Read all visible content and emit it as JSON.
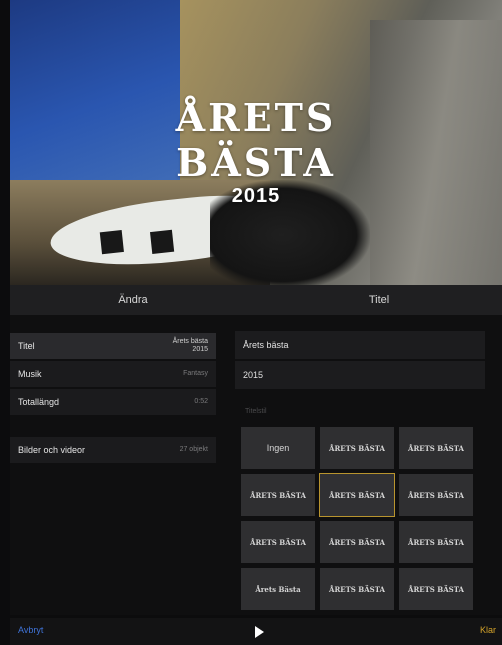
{
  "hero": {
    "line1": "ÅRETS",
    "line2": "BÄSTA",
    "year": "2015"
  },
  "tabs": {
    "left": "Ändra",
    "right": "Titel"
  },
  "settings": [
    {
      "label": "Titel",
      "value": "Årets bästa\n2015"
    },
    {
      "label": "Musik",
      "value": "Fantasy"
    },
    {
      "label": "Totallängd",
      "value": "0:52"
    }
  ],
  "media": {
    "label": "Bilder och videor",
    "value": "27 objekt"
  },
  "title_fields": {
    "line1": "Årets bästa",
    "line2": "2015"
  },
  "styles_label": "Titelstil",
  "styles": [
    "Ingen",
    "ÅRETS BÄSTA",
    "ÅRETS BÄSTA",
    "ÅRETS BÄSTA",
    "ÅRETS BÄSTA",
    "ÅRETS BÄSTA",
    "ÅRETS BÄSTA",
    "ÅRETS BÄSTA",
    "ÅRETS BÄSTA",
    "Årets Bästa",
    "ÅRETS BÄSTA",
    "ÅRETS BÄSTA"
  ],
  "bottom": {
    "left": "Avbryt",
    "right": "Klar"
  },
  "colors": {
    "accent_blue": "#3f73d8",
    "accent_gold": "#d4a32a"
  }
}
